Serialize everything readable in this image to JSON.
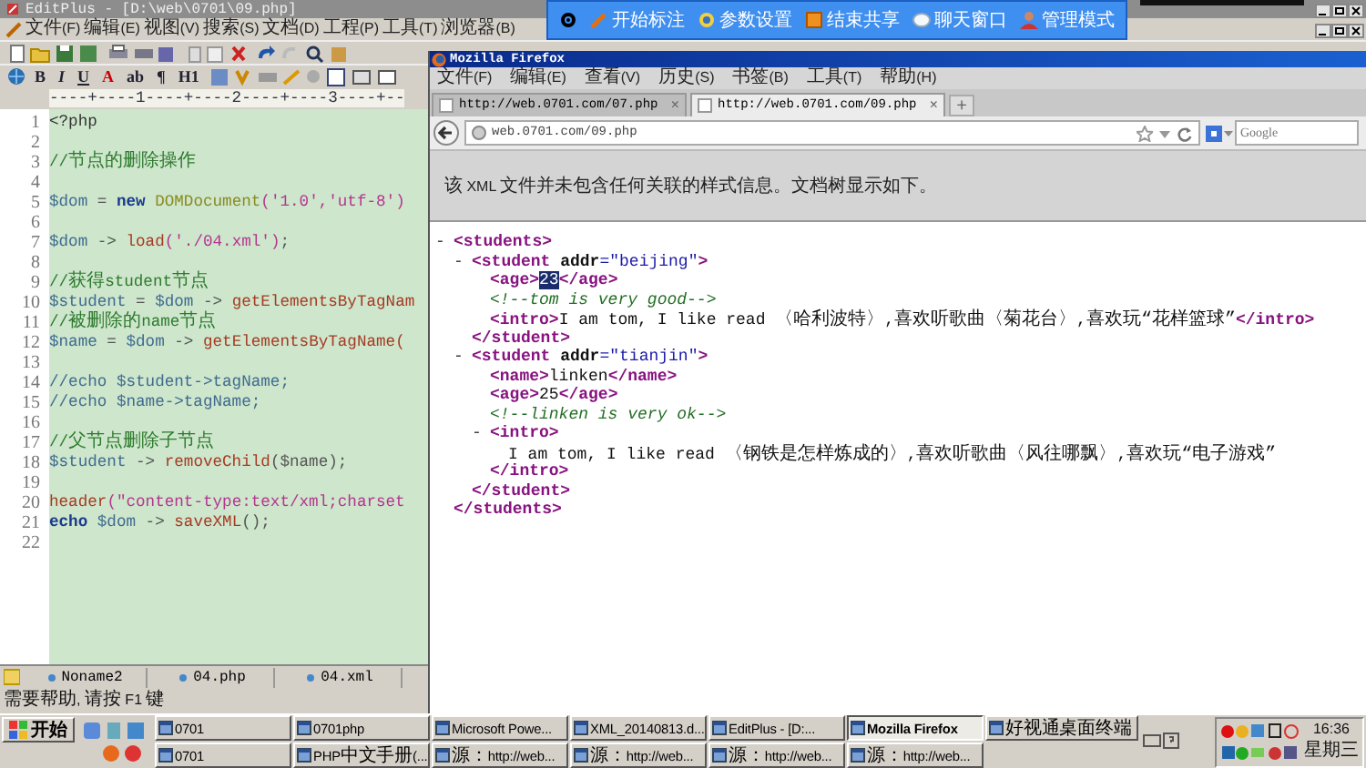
{
  "editplus": {
    "title": "EditPlus - [D:\\web\\0701\\09.php]",
    "menu": [
      "文件(F)",
      "编辑(E)",
      "视图(V)",
      "搜索(S)",
      "文档(D)",
      "工程(P)",
      "工具(T)",
      "浏览器(B)"
    ],
    "format_buttons": [
      "B",
      "I",
      "U",
      "A",
      "ab",
      "¶",
      "H1"
    ],
    "ruler": "----+----1----+----2----+----3----+--",
    "lines": [
      {
        "number": "1",
        "segments": [
          {
            "kind": "plain",
            "text": "<?php"
          }
        ]
      },
      {
        "number": "2"
      },
      {
        "number": "3",
        "segments": [
          {
            "kind": "comment",
            "text": "//节点的删除操作"
          }
        ]
      },
      {
        "number": "4"
      },
      {
        "number": "5",
        "segments": [
          {
            "kind": "var",
            "text": "$dom"
          },
          {
            "kind": "op",
            "text": " = "
          },
          {
            "kind": "kw",
            "text": "new"
          },
          {
            "kind": "cls",
            "text": " DOMDocument"
          },
          {
            "kind": "str",
            "text": "('1.0','utf-8')"
          }
        ]
      },
      {
        "number": "6"
      },
      {
        "number": "7",
        "segments": [
          {
            "kind": "var",
            "text": "$dom"
          },
          {
            "kind": "op",
            "text": " -> "
          },
          {
            "kind": "fn",
            "text": "load"
          },
          {
            "kind": "str",
            "text": "('./04.xml')"
          },
          {
            "kind": "op",
            "text": ";"
          }
        ]
      },
      {
        "number": "8"
      },
      {
        "number": "9",
        "segments": [
          {
            "kind": "comment",
            "text": "//获得student节点"
          }
        ]
      },
      {
        "number": "10",
        "segments": [
          {
            "kind": "var",
            "text": "$student"
          },
          {
            "kind": "op",
            "text": " = "
          },
          {
            "kind": "var",
            "text": "$dom"
          },
          {
            "kind": "op",
            "text": " -> "
          },
          {
            "kind": "fn",
            "text": "getElementsByTagNam"
          }
        ]
      },
      {
        "number": "11",
        "segments": [
          {
            "kind": "comment",
            "text": "//被删除的name节点"
          }
        ]
      },
      {
        "number": "12",
        "segments": [
          {
            "kind": "var",
            "text": "$name"
          },
          {
            "kind": "op",
            "text": " = "
          },
          {
            "kind": "var",
            "text": "$dom"
          },
          {
            "kind": "op",
            "text": " -> "
          },
          {
            "kind": "fn",
            "text": "getElementsByTagName("
          }
        ]
      },
      {
        "number": "13"
      },
      {
        "number": "14",
        "segments": [
          {
            "kind": "var",
            "text": "//echo $student->tagName;"
          }
        ]
      },
      {
        "number": "15",
        "segments": [
          {
            "kind": "var",
            "text": "//echo $name->tagName;"
          }
        ]
      },
      {
        "number": "16"
      },
      {
        "number": "17",
        "segments": [
          {
            "kind": "comment",
            "text": "//父节点删除子节点"
          }
        ]
      },
      {
        "number": "18",
        "segments": [
          {
            "kind": "var",
            "text": "$student"
          },
          {
            "kind": "op",
            "text": " -> "
          },
          {
            "kind": "fn",
            "text": "removeChild"
          },
          {
            "kind": "op",
            "text": "($name);"
          }
        ]
      },
      {
        "number": "19"
      },
      {
        "number": "20",
        "segments": [
          {
            "kind": "fn",
            "text": "header"
          },
          {
            "kind": "str",
            "text": "(\"content-type:text/xml;charset"
          }
        ]
      },
      {
        "number": "21",
        "segments": [
          {
            "kind": "kw",
            "text": "echo"
          },
          {
            "kind": "var",
            "text": " $dom"
          },
          {
            "kind": "op",
            "text": " -> "
          },
          {
            "kind": "fn",
            "text": "saveXML"
          },
          {
            "kind": "op",
            "text": "();"
          }
        ]
      },
      {
        "number": "22"
      }
    ],
    "file_tabs": [
      "Noname2",
      "04.php",
      "04.xml"
    ],
    "status": "需要帮助, 请按 F1 键"
  },
  "share_toolbar": [
    "开始标注",
    "参数设置",
    "结束共享",
    "聊天窗口",
    "管理模式"
  ],
  "firefox": {
    "title": "Mozilla Firefox",
    "menu": [
      "文件(F)",
      "编辑(E)",
      "查看(V)",
      "历史(S)",
      "书签(B)",
      "工具(T)",
      "帮助(H)"
    ],
    "tabs": [
      {
        "label": "http://web.0701.com/07.php",
        "close": "×",
        "selected": false
      },
      {
        "label": "http://web.0701.com/09.php",
        "close": "×",
        "selected": true
      }
    ],
    "new_tab": "+",
    "address": "web.0701.com/09.php",
    "search": {
      "placeholder": "Google"
    },
    "info": "该 XML 文件并未包含任何关联的样式信息。文档树显示如下。",
    "xml_tree": {
      "toggle": "-",
      "expanded": true,
      "open": [
        {
          "kind": "tag",
          "text": "<students>"
        }
      ],
      "close": [
        {
          "kind": "tag",
          "text": "</students>"
        }
      ],
      "children": [
        {
          "toggle": "-",
          "expanded": true,
          "open": [
            {
              "kind": "tag",
              "text": "<student "
            },
            {
              "kind": "attr",
              "text": "addr"
            },
            {
              "kind": "val",
              "text": "=\"beijing\""
            },
            {
              "kind": "tag",
              "text": ">"
            }
          ],
          "close": [
            {
              "kind": "tag",
              "text": "</student>"
            }
          ],
          "children": [
            {
              "line": [
                {
                  "kind": "tag",
                  "text": "<age>",
                  "selected": false
                },
                {
                  "kind": "text",
                  "text": "23",
                  "selected": true
                },
                {
                  "kind": "tag",
                  "text": "</age>",
                  "selected": false
                }
              ]
            },
            {
              "line": [
                {
                  "kind": "comment",
                  "text": "<!--tom is very good-->"
                }
              ]
            },
            {
              "line": [
                {
                  "kind": "tag",
                  "text": "<intro>"
                },
                {
                  "kind": "text",
                  "text": "I am tom, I like read 〈哈利波特〉,喜欢听歌曲〈菊花台〉,喜欢玩“花样篮球”"
                },
                {
                  "kind": "tag",
                  "text": "</intro>"
                }
              ]
            }
          ]
        },
        {
          "toggle": "-",
          "expanded": true,
          "open": [
            {
              "kind": "tag",
              "text": "<student "
            },
            {
              "kind": "attr",
              "text": "addr"
            },
            {
              "kind": "val",
              "text": "=\"tianjin\""
            },
            {
              "kind": "tag",
              "text": ">"
            }
          ],
          "close": [
            {
              "kind": "tag",
              "text": "</student>"
            }
          ],
          "children": [
            {
              "line": [
                {
                  "kind": "tag",
                  "text": "<name>"
                },
                {
                  "kind": "text",
                  "text": "linken"
                },
                {
                  "kind": "tag",
                  "text": "</name>"
                }
              ]
            },
            {
              "line": [
                {
                  "kind": "tag",
                  "text": "<age>"
                },
                {
                  "kind": "text",
                  "text": "25"
                },
                {
                  "kind": "tag",
                  "text": "</age>"
                }
              ]
            },
            {
              "line": [
                {
                  "kind": "comment",
                  "text": "<!--linken is very ok-->"
                }
              ]
            },
            {
              "toggle": "-",
              "expanded": true,
              "open": [
                {
                  "kind": "tag",
                  "text": "<intro>"
                }
              ],
              "close": [
                {
                  "kind": "tag",
                  "text": "</intro>"
                }
              ],
              "children": [
                {
                  "line": [
                    {
                      "kind": "text",
                      "text": "I am tom, I like read 〈钢铁是怎样炼成的〉,喜欢听歌曲〈风往哪飘〉,喜欢玩“电子游戏”"
                    }
                  ]
                }
              ]
            }
          ]
        }
      ]
    }
  },
  "taskbar": {
    "start": "开始",
    "buttons": [
      {
        "label": "0701",
        "selected": false
      },
      {
        "label": "0701php",
        "selected": false
      },
      {
        "label": "Microsoft Powe...",
        "selected": false
      },
      {
        "label": "XML_20140813.d...",
        "selected": false
      },
      {
        "label": "EditPlus - [D:...",
        "selected": false
      },
      {
        "label": "Mozilla Firefox",
        "selected": true
      },
      {
        "label": "好视通桌面终端",
        "selected": false
      },
      {
        "label": "0701",
        "selected": false
      },
      {
        "label": "PHP中文手册(...",
        "selected": false
      },
      {
        "label": "源：http://web...",
        "selected": false
      },
      {
        "label": "源：http://web...",
        "selected": false
      },
      {
        "label": "源：http://web...",
        "selected": false
      },
      {
        "label": "源：http://web...",
        "selected": false
      }
    ],
    "time": "16:36",
    "day": "星期三"
  }
}
